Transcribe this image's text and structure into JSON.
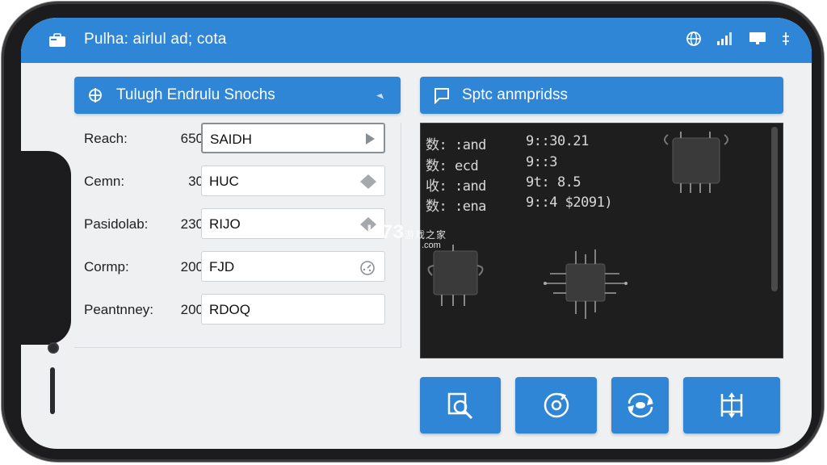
{
  "app": {
    "title": "Pulha: airlul ad; cota"
  },
  "status_icons": [
    "globe-icon",
    "signal-bars-icon",
    "monitor-icon",
    "sort-icon"
  ],
  "left_panel": {
    "header": "Tulugh Endrulu Snochs",
    "rows": [
      {
        "label": "Reach:",
        "number": "650",
        "value": "SAIDH",
        "icon": "play-icon"
      },
      {
        "label": "Cemn:",
        "number": "30",
        "value": "HUC",
        "icon": "diamond-icon"
      },
      {
        "label": "Pasidolab:",
        "number": "230",
        "value": "RIJO",
        "icon": "diamond-icon"
      },
      {
        "label": "Cormp:",
        "number": "200",
        "value": "FJD",
        "icon": "gauge-icon"
      },
      {
        "label": "Peantnney:",
        "number": "200",
        "value": "RDOQ",
        "icon": ""
      }
    ]
  },
  "right_panel": {
    "header": "Sptc anmpridss",
    "console_lines": [
      {
        "key": "数: :and",
        "value": "9::30.21"
      },
      {
        "key": "数: ecd",
        "value": "9::3"
      },
      {
        "key": "收: :and",
        "value": "9t: 8.5"
      },
      {
        "key": "数: :ena",
        "value": "9::4  $2091)"
      }
    ],
    "watermark": {
      "main": "K73",
      "sub_cn": "游戏之家",
      "sub": ".com"
    }
  },
  "actions": [
    {
      "name": "scan-button",
      "icon": "search-document-icon"
    },
    {
      "name": "rotate-button",
      "icon": "refresh-icon"
    },
    {
      "name": "sync-button",
      "icon": "sync-icon"
    },
    {
      "name": "resize-button",
      "icon": "resize-icon"
    }
  ],
  "colors": {
    "accent": "#2f86d6",
    "console_bg": "#1e1e1e",
    "screen_bg": "#eef0f2"
  }
}
